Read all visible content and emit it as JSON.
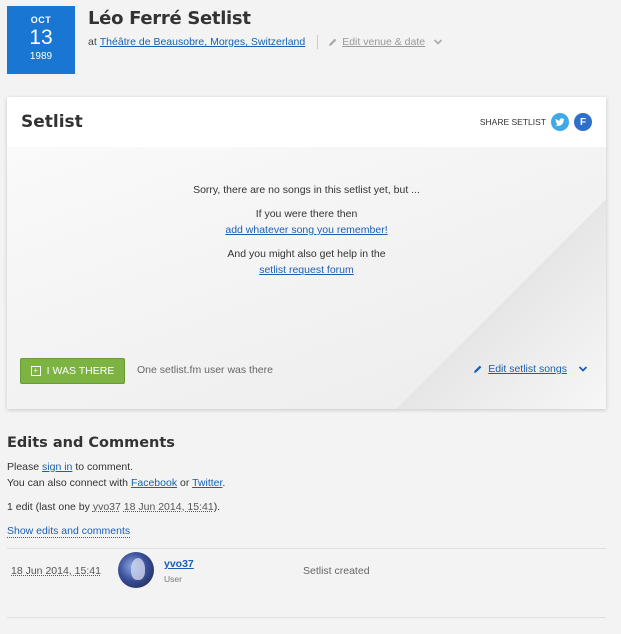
{
  "date": {
    "month": "OCT",
    "day": "13",
    "year": "1989"
  },
  "page_title": "Léo Ferré Setlist",
  "venue": {
    "prefix": "at",
    "name": "Théâtre de Beausobre, Morges, Switzerland",
    "edit_label": "Edit venue & date"
  },
  "setlist": {
    "title": "Setlist",
    "share_label": "SHARE SETLIST",
    "empty_msg": "Sorry, there are no songs in this setlist yet, but ...",
    "if_there": "If you were there then",
    "add_link": "add whatever song you remember!",
    "help_text": "And you might also get help in the",
    "forum_link": "setlist request forum",
    "i_was_there": "I WAS THERE",
    "users_there": "One setlist.fm user was there",
    "edit_songs": "Edit setlist songs"
  },
  "edits": {
    "title": "Edits and Comments",
    "please": "Please",
    "sign_in": "sign in",
    "to_comment": "to comment.",
    "connect_text": "You can also connect with",
    "facebook": "Facebook",
    "or": "or",
    "twitter": "Twitter",
    "period": ".",
    "edit_count_prefix": "1 edit (last one by",
    "edit_user": "yvo37",
    "edit_date": "18 Jun 2014, 15:41",
    "edit_count_suffix": ").",
    "show_edits": "Show edits and comments",
    "row": {
      "date": "18 Jun 2014, 15:41",
      "user": "yvo37",
      "role": "User",
      "action": "Setlist created"
    }
  },
  "colors": {
    "brand_blue": "#1976d2",
    "link": "#1a5fb4",
    "green_button": "#7cb342",
    "twitter": "#3fa9e8",
    "facebook": "#2f6fc9"
  },
  "icons": [
    "pencil-icon",
    "chevron-down-icon",
    "twitter-icon",
    "facebook-icon",
    "plus-square-icon"
  ]
}
